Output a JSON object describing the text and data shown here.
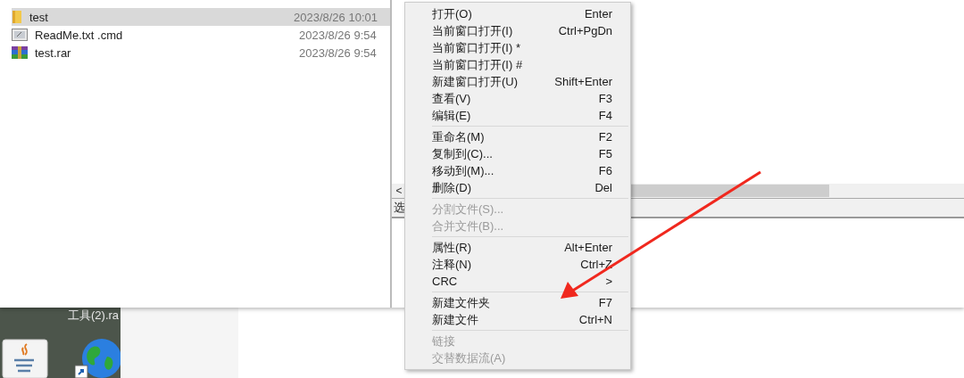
{
  "files": [
    {
      "name": "test",
      "modified": "2023/8/26 10:01",
      "kind": "folder",
      "selected": true
    },
    {
      "name": "ReadMe.txt .cmd",
      "modified": "2023/8/26 9:54",
      "kind": "script",
      "selected": false
    },
    {
      "name": "test.rar",
      "modified": "2023/8/26 9:54",
      "kind": "archive",
      "selected": false
    }
  ],
  "pane": {
    "scroll_left": "<",
    "status": "选"
  },
  "context_menu": {
    "groups": [
      [
        {
          "label": "打开(O)",
          "shortcut": "Enter",
          "disabled": false
        },
        {
          "label": "当前窗口打开(I)",
          "shortcut": "Ctrl+PgDn",
          "disabled": false
        },
        {
          "label": "当前窗口打开(I) *",
          "disabled": false
        },
        {
          "label": "当前窗口打开(I) #",
          "disabled": false
        },
        {
          "label": "新建窗口打开(U)",
          "shortcut": "Shift+Enter",
          "disabled": false
        },
        {
          "label": "查看(V)",
          "shortcut": "F3",
          "disabled": false
        },
        {
          "label": "编辑(E)",
          "shortcut": "F4",
          "disabled": false
        }
      ],
      [
        {
          "label": "重命名(M)",
          "shortcut": "F2",
          "disabled": false
        },
        {
          "label": "复制到(C)...",
          "shortcut": "F5",
          "disabled": false
        },
        {
          "label": "移动到(M)...",
          "shortcut": "F6",
          "disabled": false
        },
        {
          "label": "删除(D)",
          "shortcut": "Del",
          "disabled": false
        }
      ],
      [
        {
          "label": "分割文件(S)...",
          "disabled": true
        },
        {
          "label": "合并文件(B)...",
          "disabled": true
        }
      ],
      [
        {
          "label": "属性(R)",
          "shortcut": "Alt+Enter",
          "disabled": false
        },
        {
          "label": "注释(N)",
          "shortcut": "Ctrl+Z",
          "disabled": false
        },
        {
          "label": "CRC",
          "submenu": ">",
          "disabled": false
        }
      ],
      [
        {
          "label": "新建文件夹",
          "shortcut": "F7",
          "disabled": false
        },
        {
          "label": "新建文件",
          "shortcut": "Ctrl+N",
          "disabled": false
        }
      ],
      [
        {
          "label": "链接",
          "disabled": true
        },
        {
          "label": "交替数据流(A)",
          "disabled": true
        }
      ]
    ]
  },
  "desktop": {
    "label": "工具(2).ra",
    "icons": [
      {
        "kind": "java"
      },
      {
        "kind": "globe"
      }
    ]
  }
}
